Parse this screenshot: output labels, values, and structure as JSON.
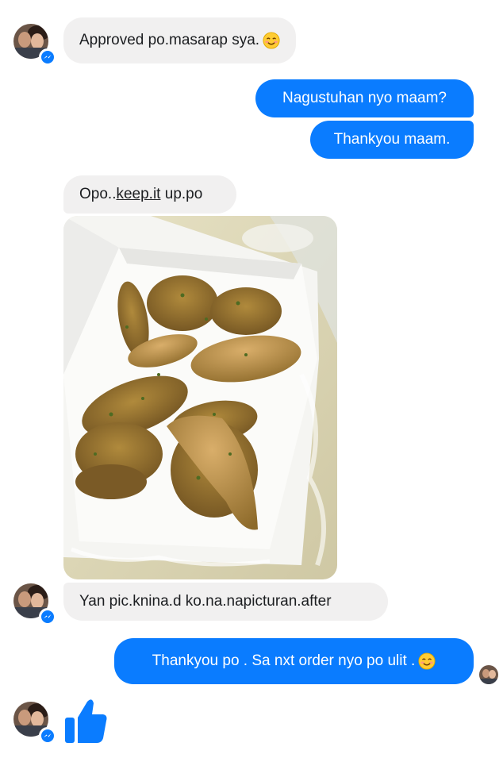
{
  "messages": [
    {
      "text": "Approved po.masarap sya.",
      "emoji": "smiling-face-icon"
    },
    {
      "text": "Nagustuhan nyo maam?"
    },
    {
      "text": "Thankyou maam."
    },
    {
      "text_before": "Opo..",
      "link": "keep.it",
      "text_after": " up.po"
    },
    {
      "text": "Yan pic.knina.d ko.na.napicturan.after"
    },
    {
      "text": "Thankyou po . Sa nxt order nyo po ulit .",
      "emoji": "smiling-face-icon"
    }
  ],
  "colors": {
    "outgoing": "#0a7cff",
    "incoming": "#f1f0f0",
    "like": "#0a7cff"
  },
  "photo": {
    "subject": "fried chicken wings in a white paper box"
  },
  "like_icon": "thumbs-up-icon"
}
